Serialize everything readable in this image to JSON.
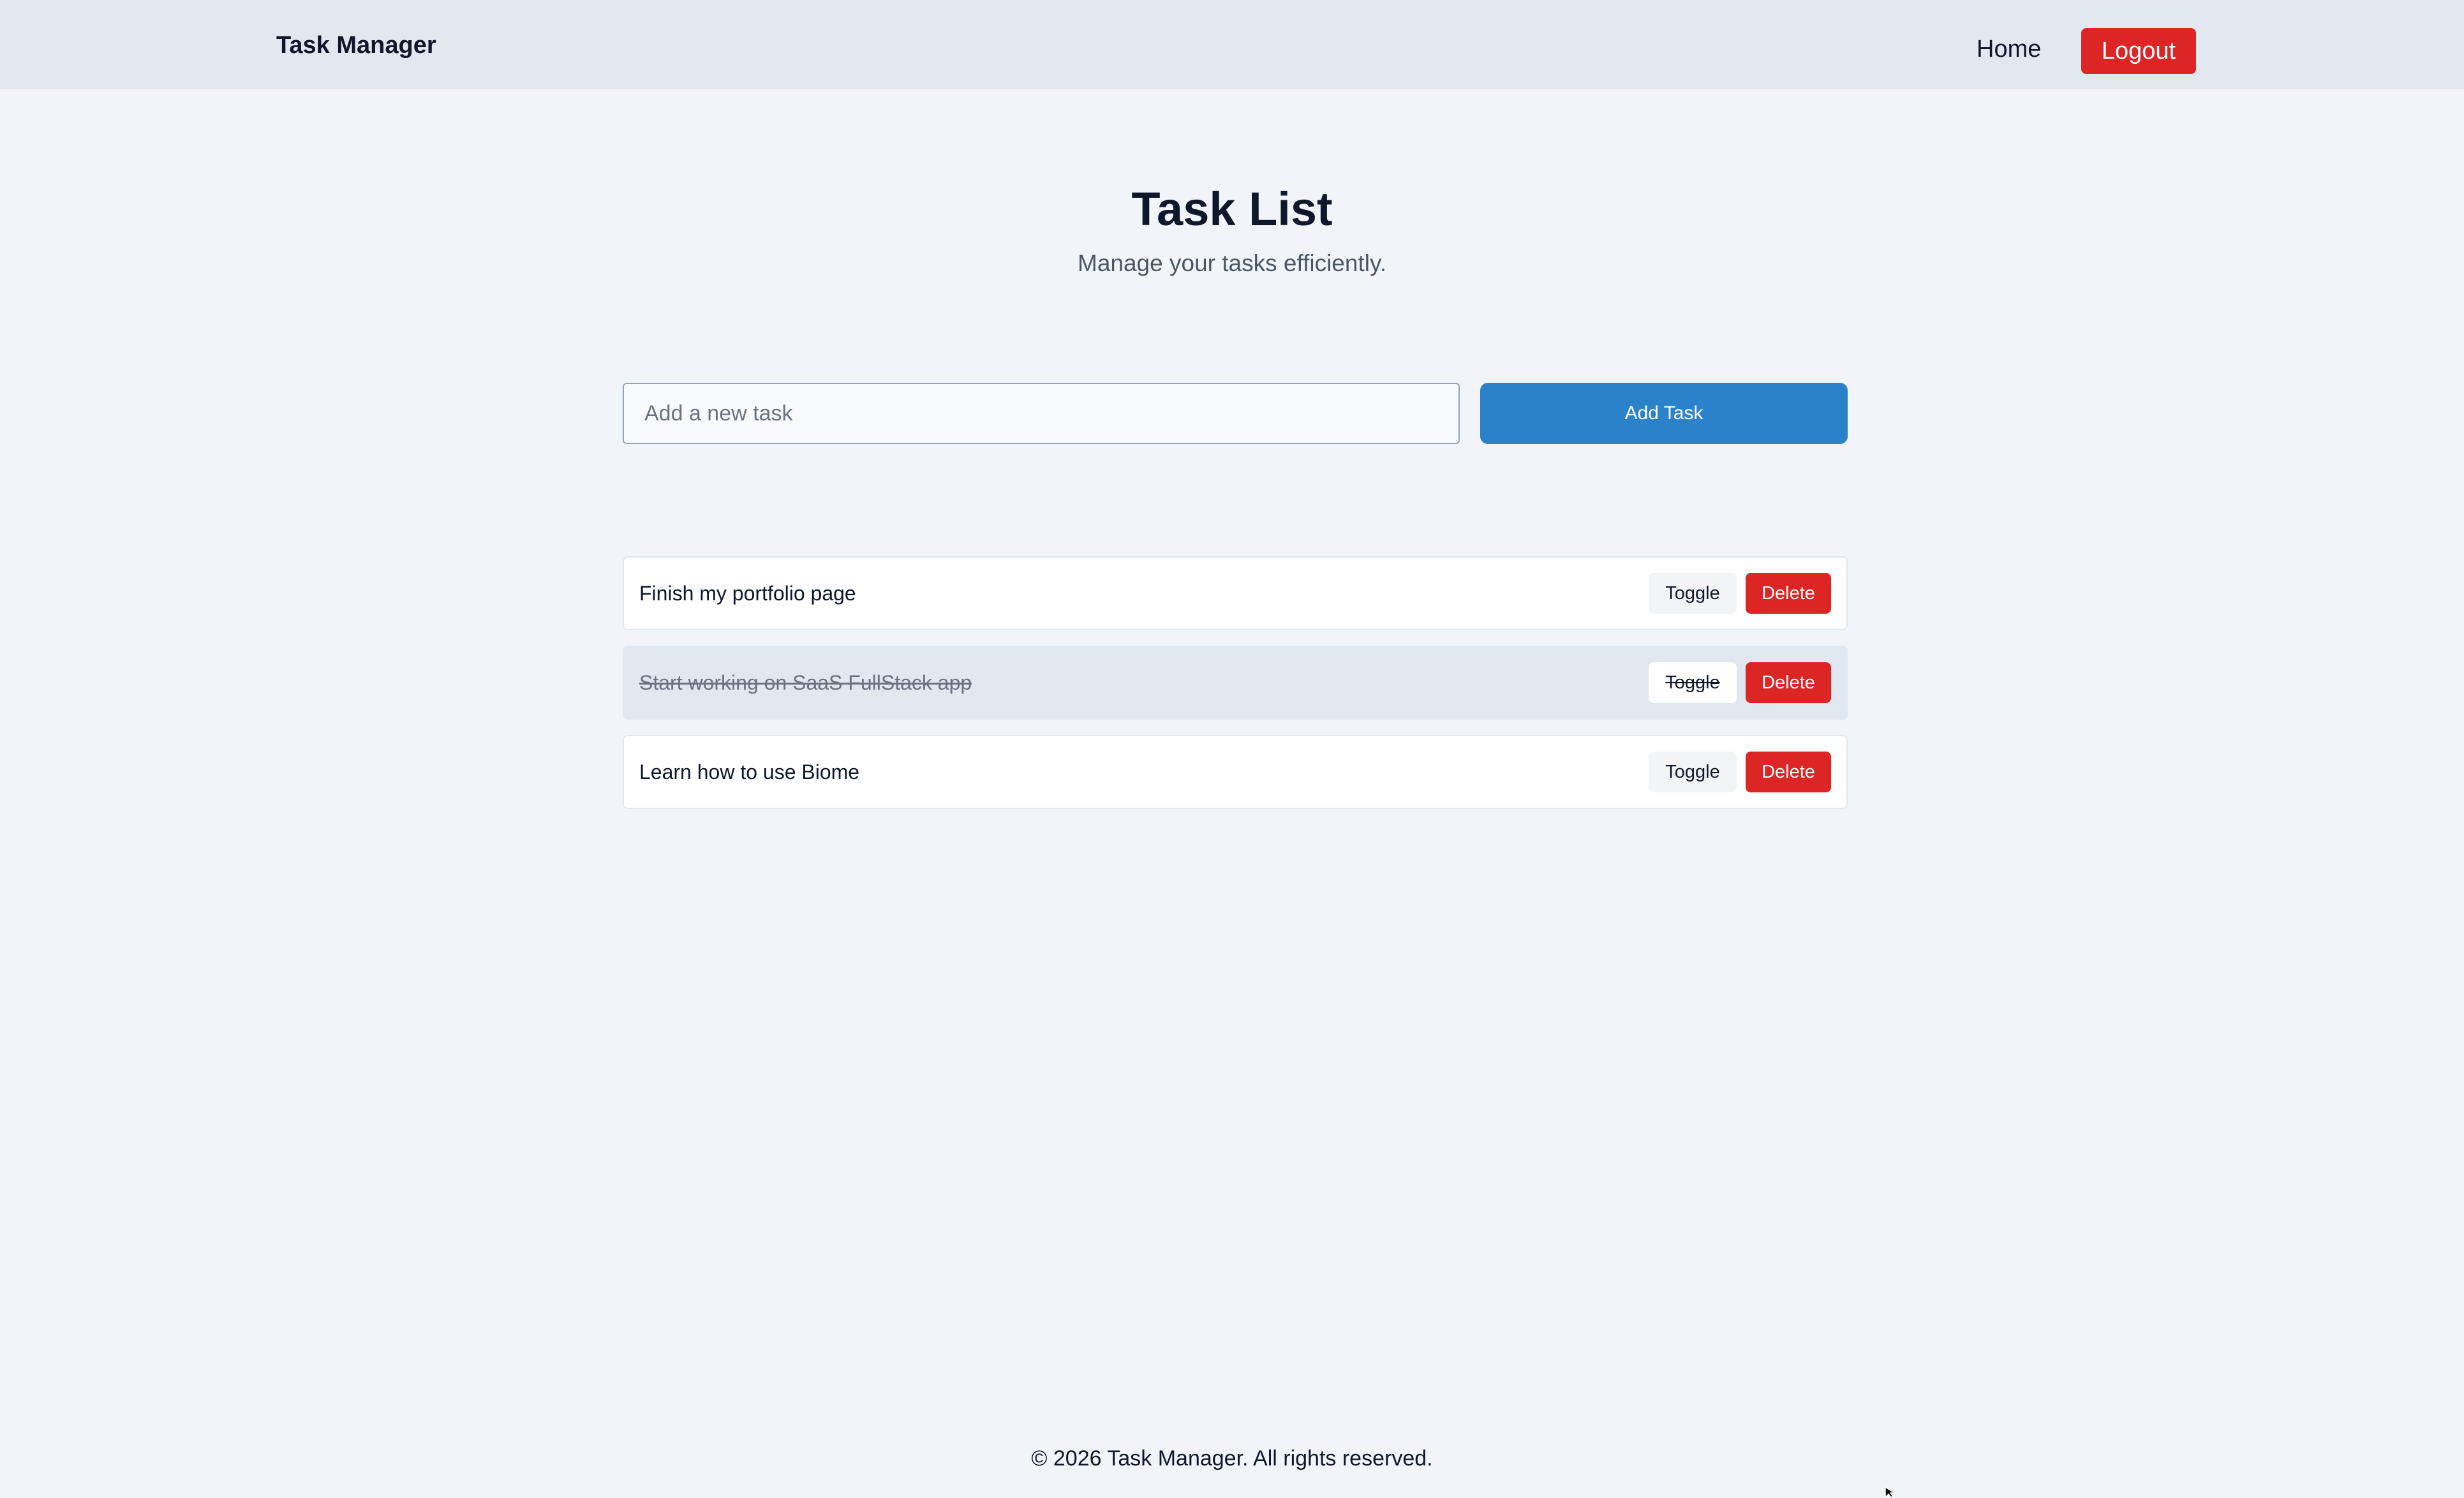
{
  "navbar": {
    "brand": "Task Manager",
    "home_link": "Home",
    "logout_button": "Logout"
  },
  "header": {
    "title": "Task List",
    "subtitle": "Manage your tasks efficiently."
  },
  "form": {
    "input_value": "",
    "input_placeholder": "Add a new task",
    "add_button": "Add Task"
  },
  "tasks": [
    {
      "text": "Finish my portfolio page",
      "completed": false,
      "toggle_label": "Toggle",
      "delete_label": "Delete"
    },
    {
      "text": "Start working on SaaS FullStack app",
      "completed": true,
      "toggle_label": "Toggle",
      "delete_label": "Delete"
    },
    {
      "text": "Learn how to use Biome",
      "completed": false,
      "toggle_label": "Toggle",
      "delete_label": "Delete"
    }
  ],
  "footer": {
    "text": "© 2026 Task Manager. All rights reserved."
  },
  "colors": {
    "navbar_bg": "#e2e8f0",
    "page_bg": "#f1f5f9",
    "primary": "#2b82cb",
    "danger": "#dc2626",
    "completed_row_bg": "#e2e8f0"
  },
  "icons": {
    "cursor": "mouse-pointer-icon"
  }
}
